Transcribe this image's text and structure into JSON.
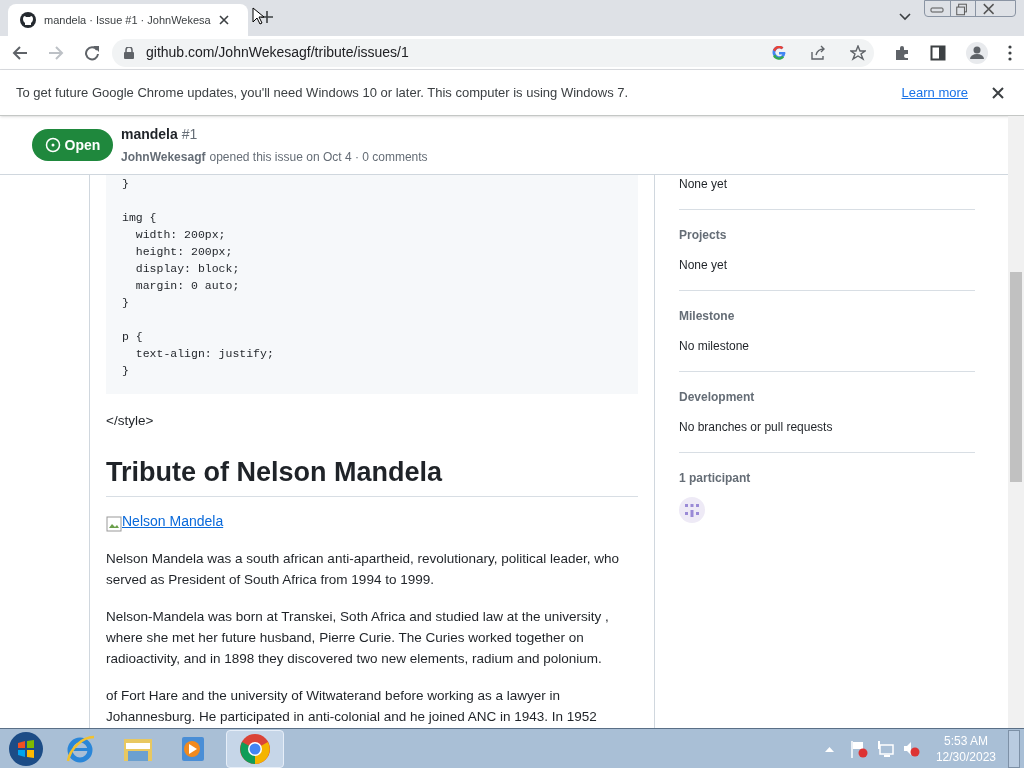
{
  "browser": {
    "tab": {
      "title": "mandela · Issue #1 · JohnWekesa",
      "selected": true
    },
    "address": "github.com/JohnWekesagf/tribute/issues/1"
  },
  "infobar": {
    "message": "To get future Google Chrome updates, you'll need Windows 10 or later. This computer is using Windows 7.",
    "link": "Learn more"
  },
  "issue_header": {
    "state": "Open",
    "title": "mandela",
    "number": "#1",
    "author": "JohnWekesagf",
    "meta": "opened this issue on Oct 4 · 0 comments"
  },
  "code_blocks": [
    [
      "}"
    ],
    [
      "img {",
      "  width: 200px;",
      "  height: 200px;",
      "  display: block;",
      "  margin: 0 auto;",
      "}"
    ],
    [
      "p {",
      "  text-align: justify;",
      "}"
    ]
  ],
  "body": [
    {
      "kind": "text",
      "text": "</style>"
    },
    {
      "kind": "heading",
      "text": "Tribute of Nelson Mandela"
    },
    {
      "kind": "image_link",
      "text": "Nelson Mandela"
    },
    {
      "kind": "text",
      "text": "Nelson Mandela was a south african anti-apartheid, revolutionary, political leader, who served as President of South Africa from 1994 to 1999."
    },
    {
      "kind": "text",
      "text": "Nelson-Mandela was born at Transkei, Soth Africa and studied law at the university , where she met her future husband, Pierre Curie. The Curies worked together on radioactivity, and in 1898 they discovered two new elements, radium and polonium."
    },
    {
      "kind": "text",
      "text": "of Fort Hare and the university of Witwaterand before working as a lawyer in Johannesburg. He participated in anti-colonial and he joined ANC in 1943. In 1952"
    }
  ],
  "sidebar": [
    {
      "value": "None yet"
    },
    {
      "label": "Projects",
      "value": "None yet"
    },
    {
      "label": "Milestone",
      "value": "No milestone"
    },
    {
      "label": "Development",
      "value": "No branches or pull requests"
    }
  ],
  "participants": {
    "label": "1 participant"
  },
  "taskbar": {
    "time": "5:53 AM",
    "date": "12/30/2023"
  }
}
